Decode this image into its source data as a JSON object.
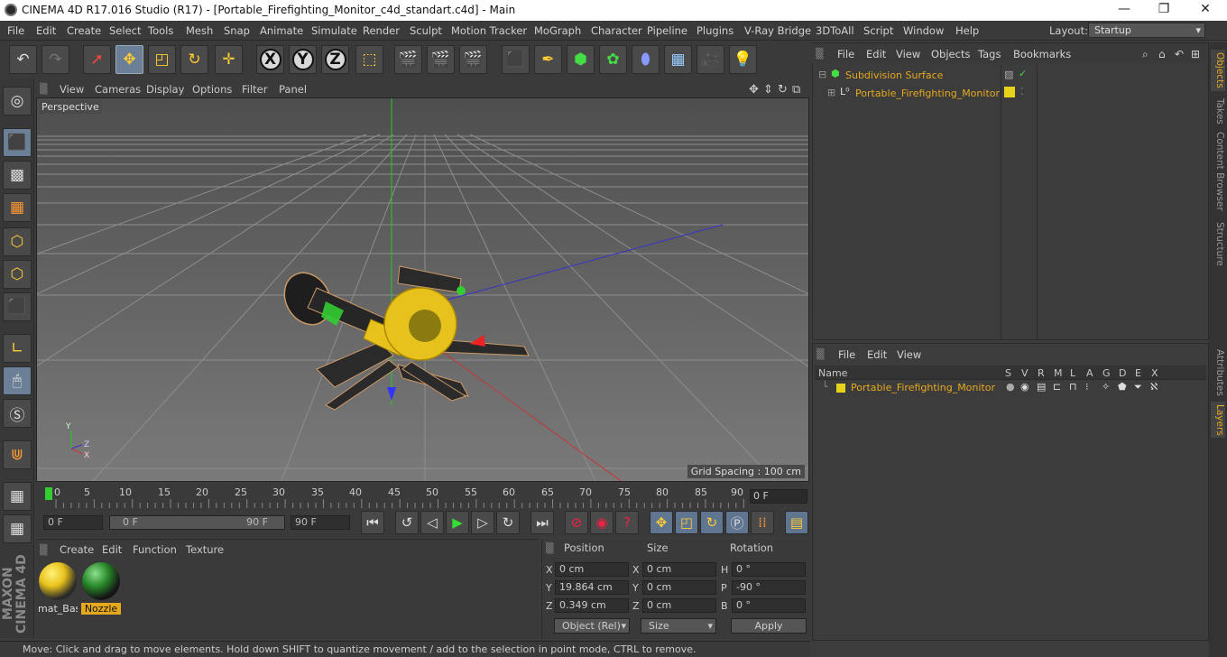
{
  "titlebar": {
    "title": "CINEMA 4D R17.016 Studio (R17) - [Portable_Firefighting_Monitor_c4d_standart.c4d] - Main",
    "minimize": "—",
    "maximize": "❐",
    "close": "✕"
  },
  "menubar": {
    "items": [
      "File",
      "Edit",
      "Create",
      "Select",
      "Tools",
      "Mesh",
      "Snap",
      "Animate",
      "Simulate",
      "Render",
      "Sculpt",
      "Motion Tracker",
      "MoGraph",
      "Character",
      "Pipeline",
      "Plugins",
      "V-Ray Bridge",
      "3DToAll",
      "Script",
      "Window",
      "Help"
    ],
    "layout_label": "Layout:",
    "layout_value": "Startup"
  },
  "viewport": {
    "menu": [
      "View",
      "Cameras",
      "Display",
      "Options",
      "Filter",
      "Panel"
    ],
    "camera_label": "Perspective",
    "grid_spacing": "Grid Spacing : 100 cm"
  },
  "timeline": {
    "ticks": [
      "0",
      "5",
      "10",
      "15",
      "20",
      "25",
      "30",
      "35",
      "40",
      "45",
      "50",
      "55",
      "60",
      "65",
      "70",
      "75",
      "80",
      "85",
      "90"
    ],
    "current_frame": "0 F"
  },
  "playbar": {
    "start_field": "0 F",
    "range_start": "0 F",
    "range_end": "90 F",
    "end_field": "90 F"
  },
  "materials": {
    "menu": [
      "Create",
      "Edit",
      "Function",
      "Texture"
    ],
    "items": [
      {
        "name": "mat_Bas",
        "selected": false
      },
      {
        "name": "Nozzle",
        "selected": true
      }
    ]
  },
  "coordinates": {
    "headers": {
      "position": "Position",
      "size": "Size",
      "rotation": "Rotation"
    },
    "rows": [
      {
        "axis": "X",
        "pos": "0 cm",
        "size_axis": "X",
        "size": "0 cm",
        "rot_axis": "H",
        "rot": "0 °"
      },
      {
        "axis": "Y",
        "pos": "19.864 cm",
        "size_axis": "Y",
        "size": "0 cm",
        "rot_axis": "P",
        "rot": "-90 °"
      },
      {
        "axis": "Z",
        "pos": "0.349 cm",
        "size_axis": "Z",
        "size": "0 cm",
        "rot_axis": "B",
        "rot": "0 °"
      }
    ],
    "mode_dropdown": "Object (Rel)",
    "size_dropdown": "Size",
    "apply_label": "Apply"
  },
  "status": {
    "text": "Move: Click and drag to move elements. Hold down SHIFT to quantize movement / add to the selection in point mode, CTRL to remove."
  },
  "objects_panel": {
    "menu": [
      "File",
      "Edit",
      "View",
      "Objects",
      "Tags",
      "Bookmarks"
    ],
    "items": [
      {
        "name": "Subdivision Surface",
        "color": "#e6a91e"
      },
      {
        "name": "Portable_Firefighting_Monitor",
        "color": "#e6a91e"
      }
    ]
  },
  "layers_panel": {
    "menu": [
      "File",
      "Edit",
      "View"
    ],
    "name_header": "Name",
    "columns": [
      "S",
      "V",
      "R",
      "M",
      "L",
      "A",
      "G",
      "D",
      "E",
      "X"
    ],
    "items": [
      {
        "name": "Portable_Firefighting_Monitor"
      }
    ]
  },
  "sidetabs": {
    "tabs": [
      "Objects",
      "Takes",
      "Content Browser",
      "Structure",
      "Attributes",
      "Layers"
    ]
  },
  "colors": {
    "accent": "#e6a91e",
    "selection_blue": "#6b7f96"
  }
}
